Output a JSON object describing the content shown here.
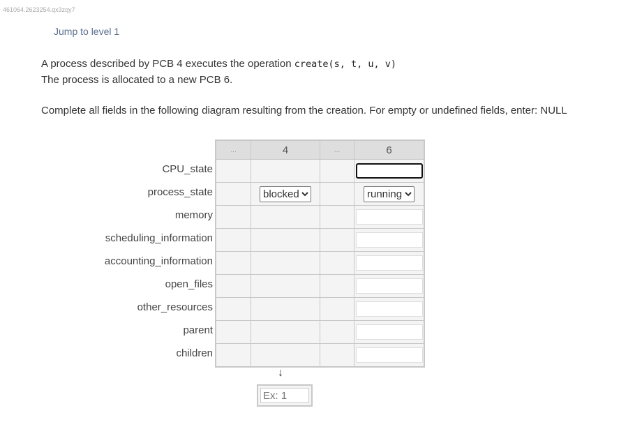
{
  "uid": "461064.2623254.qx3zqy7",
  "jump_link": "Jump to level 1",
  "line1_prefix": "A process described by PCB 4 executes the operation ",
  "line1_code": "create(s, t, u, v)",
  "line2": "The process is allocated to a new PCB 6.",
  "instructions": "Complete all fields in the following diagram resulting from the creation. For empty or undefined fields, enter: NULL",
  "columns": [
    "...",
    "4",
    "...",
    "6"
  ],
  "rows": [
    "CPU_state",
    "process_state",
    "memory",
    "scheduling_information",
    "accounting_information",
    "open_files",
    "other_resources",
    "parent",
    "children"
  ],
  "pcb4_process_state": "blocked",
  "pcb6_process_state": "running",
  "arrow": "↓",
  "ex_placeholder": "Ex: 1"
}
